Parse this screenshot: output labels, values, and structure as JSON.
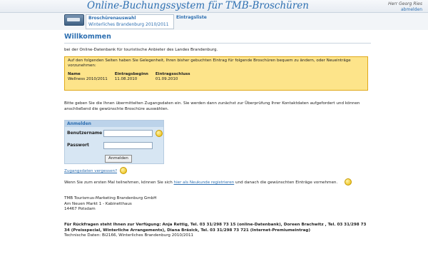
{
  "header": {
    "title": "Online-Buchungssystem für TMB-Broschüren",
    "user_name": "Herr Georg Ries",
    "logout": "abmelden"
  },
  "nav": {
    "section": "Broschürenauswahl",
    "selected": "Winterliches Brandenburg 2010/2011",
    "tab_entries": "Eintragsliste"
  },
  "main": {
    "heading": "Willkommen",
    "intro": "bei der Online-Datenbank für touristische Anbieter des Landes Brandenburg.",
    "notice": {
      "text": "Auf den folgenden Seiten haben Sie Gelegenheit, Ihren bisher gebuchten Eintrag für folgende Broschüren bequem zu ändern, oder Neueinträge vorzunehmen:",
      "columns": [
        "Name",
        "Eintragsbeginn",
        "Eintragsschluss"
      ],
      "rows": [
        [
          "Wellness 2010/2011",
          "11.08.2010",
          "01.09.2010"
        ]
      ]
    },
    "instructions": "Bitte geben Sie die Ihnen übermittelten Zugangsdaten ein. Sie werden dann zunächst zur Überprüfung Ihrer Kontaktdaten aufgefordert und können anschließend die gewünschte Broschüre auswählen.",
    "login": {
      "title": "Anmelden",
      "user_label": "Benutzername",
      "pass_label": "Passwort",
      "submit": "Anmelden"
    },
    "forgot": "Zugangsdaten vergessen?",
    "register_pre": "Wenn Sie zum ersten Mal teilnehmen, können Sie sich ",
    "register_link": "hier als Neukunde registrieren",
    "register_post": " und danach die gewünschten Einträge vornehmen.",
    "address": [
      "TMB Tourismus-Marketing Brandenburg GmbH",
      "Am Neuen Markt 1 - Kabinetthaus",
      "14467 Potsdam"
    ],
    "contact": "Für Rückfragen steht Ihnen zur Verfügung: Anja Rettig, Tel. 03 31/298 73 15 (online-Datenbank), Doreen Brachwitz , Tel. 03 31/298 73 34 (Preisspecial, Winterliche Arrangements), Diana Bräsick, Tel. 03 31/298 73 721 (Internet-Premiumeintrag)",
    "technical": "Technische Daten: Bi2166, Winterliches Brandenburg 2010/2011"
  },
  "colors": {
    "accent": "#2d6fb1",
    "notice_bg": "#fde48a",
    "login_bg": "#d7e6f3"
  }
}
